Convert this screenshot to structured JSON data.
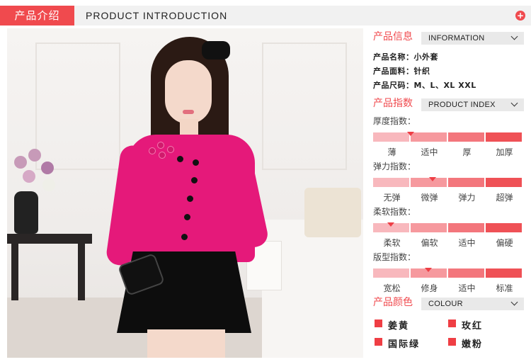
{
  "header": {
    "title_cn": "产品介绍",
    "title_en": "PRODUCT INTRODUCTION",
    "expand_icon": "plus-circle-icon"
  },
  "photo": {
    "subject": "model-wearing-pink-jacket-and-black-skirt"
  },
  "info": {
    "title_cn": "产品信息",
    "title_en": "INFORMATION",
    "lines": [
      {
        "label": "产品名称：",
        "value": "小外套"
      },
      {
        "label": "产品面料：",
        "value": "针织"
      },
      {
        "label": "产品尺码：",
        "value": "M、L、XL XXL"
      }
    ]
  },
  "index": {
    "title_cn": "产品指数",
    "title_en": "PRODUCT INDEX",
    "rows": [
      {
        "label": "厚度指数：",
        "ticks": [
          "薄",
          "适中",
          "厚",
          "加厚"
        ],
        "level": 0.25
      },
      {
        "label": "弹力指数：",
        "ticks": [
          "无弹",
          "微弹",
          "弹力",
          "超弹"
        ],
        "level": 0.4
      },
      {
        "label": "柔软指数：",
        "ticks": [
          "柔软",
          "偏软",
          "适中",
          "偏硬"
        ],
        "level": 0.12
      },
      {
        "label": "版型指数：",
        "ticks": [
          "宽松",
          "修身",
          "适中",
          "标准"
        ],
        "level": 0.37
      }
    ]
  },
  "colour": {
    "title_cn": "产品颜色",
    "title_en": "COLOUR",
    "items": [
      "姜黄",
      "玫红",
      "国际绿",
      "嫩粉"
    ]
  },
  "colors": {
    "accent": "#f04a4e",
    "jacket": "#e5197a",
    "bar_light": "#f8b8bd",
    "bar_dark": "#ef5156"
  }
}
